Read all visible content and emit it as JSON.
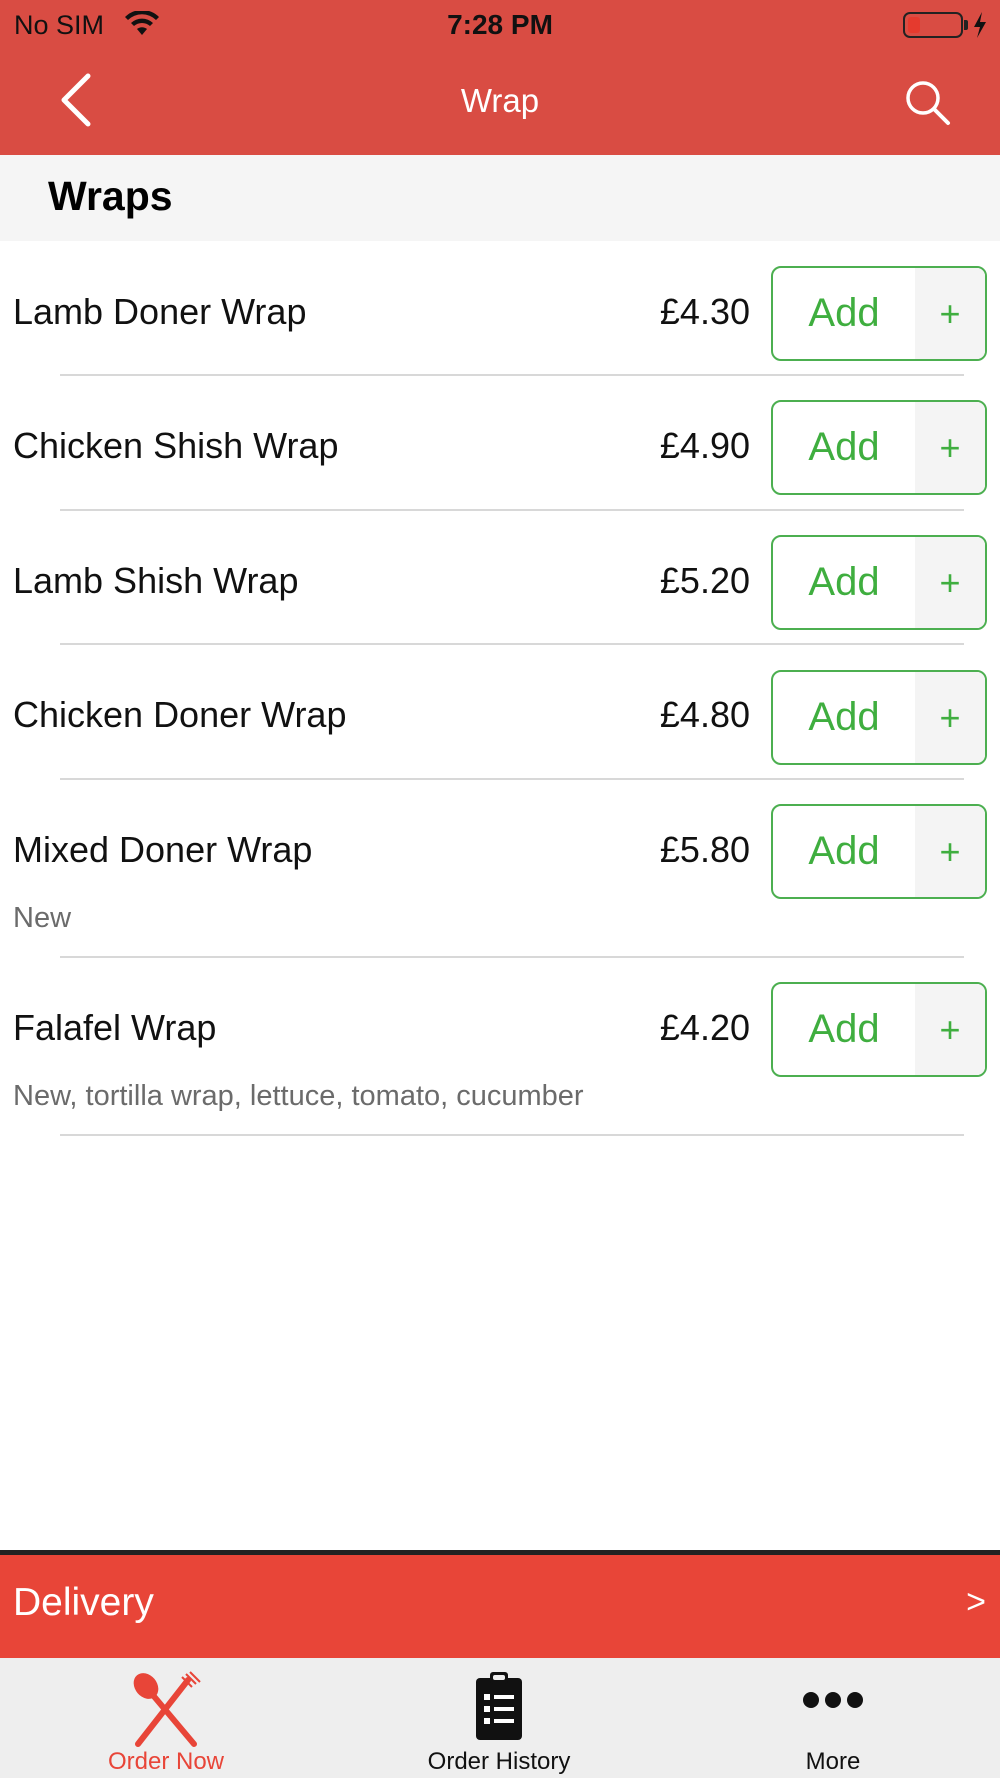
{
  "status_bar": {
    "carrier": "No SIM",
    "time": "7:28 PM"
  },
  "nav": {
    "title": "Wrap"
  },
  "section": {
    "title": "Wraps"
  },
  "items": [
    {
      "name": "Lamb Doner Wrap",
      "price": "£4.30",
      "description": ""
    },
    {
      "name": "Chicken Shish Wrap",
      "price": "£4.90",
      "description": ""
    },
    {
      "name": "Lamb Shish Wrap",
      "price": "£5.20",
      "description": ""
    },
    {
      "name": "Chicken Doner Wrap",
      "price": "£4.80",
      "description": ""
    },
    {
      "name": "Mixed Doner Wrap",
      "price": "£5.80",
      "description": "New"
    },
    {
      "name": "Falafel Wrap",
      "price": "£4.20",
      "description": "New, tortilla wrap, lettuce, tomato, cucumber"
    }
  ],
  "add_button": {
    "label": "Add",
    "plus": "+"
  },
  "delivery": {
    "label": "Delivery",
    "arrow": ">"
  },
  "tabs": [
    {
      "label": "Order Now",
      "icon": "fork-knife-icon",
      "active": true
    },
    {
      "label": "Order History",
      "icon": "clipboard-list-icon",
      "active": false
    },
    {
      "label": "More",
      "icon": "more-dots-icon",
      "active": false
    }
  ],
  "colors": {
    "brand_red": "#d94c43",
    "delivery_red": "#e84538",
    "add_green": "#4caf50",
    "active_tab": "#e84538"
  }
}
